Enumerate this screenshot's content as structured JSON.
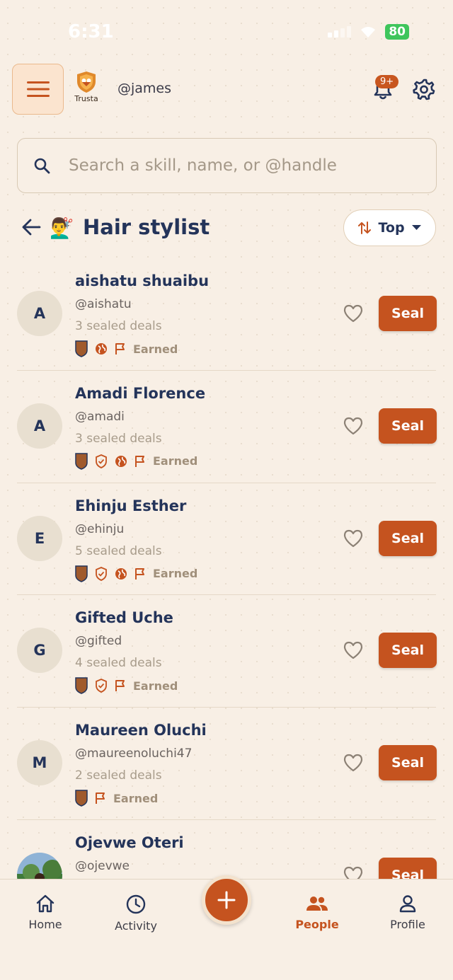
{
  "status": {
    "time": "6:31",
    "battery": "80"
  },
  "header": {
    "logo_text": "Trusta",
    "handle": "@james",
    "notification_badge": "9+"
  },
  "search": {
    "placeholder": "Search a skill, name, or @handle",
    "value": ""
  },
  "category": {
    "emoji": "💇‍♂️",
    "title": "Hair stylist",
    "sort_label": "Top"
  },
  "people": [
    {
      "initial": "A",
      "name": "aishatu shuaibu",
      "handle": "@aishatu",
      "deals": "3 sealed deals",
      "badges": [
        "shield-badge",
        "globe",
        "flag"
      ],
      "earned": "Earned",
      "action": "Seal"
    },
    {
      "initial": "A",
      "name": "Amadi Florence",
      "handle": "@amadi",
      "deals": "3 sealed deals",
      "badges": [
        "shield-badge",
        "shield-check",
        "globe",
        "flag"
      ],
      "earned": "Earned",
      "action": "Seal"
    },
    {
      "initial": "E",
      "name": "Ehinju Esther",
      "handle": "@ehinju",
      "deals": "5 sealed deals",
      "badges": [
        "shield-badge",
        "shield-check",
        "globe",
        "flag"
      ],
      "earned": "Earned",
      "action": "Seal"
    },
    {
      "initial": "G",
      "name": "Gifted Uche",
      "handle": "@gifted",
      "deals": "4 sealed deals",
      "badges": [
        "shield-badge",
        "shield-check",
        "flag"
      ],
      "earned": "Earned",
      "action": "Seal"
    },
    {
      "initial": "M",
      "name": "Maureen Oluchi",
      "handle": "@maureenoluchi47",
      "deals": "2 sealed deals",
      "badges": [
        "shield-badge",
        "flag"
      ],
      "earned": "Earned",
      "action": "Seal"
    },
    {
      "initial": "",
      "name": "Ojevwe Oteri",
      "handle": "@ojevwe",
      "deals": "",
      "badges": [],
      "earned": "",
      "action": "Seal",
      "photo": true
    }
  ],
  "nav": {
    "items": [
      {
        "label": "Home",
        "icon": "home-icon"
      },
      {
        "label": "Activity",
        "icon": "clock-icon"
      },
      {
        "label": "People",
        "icon": "people-icon",
        "active": true
      },
      {
        "label": "Profile",
        "icon": "person-icon"
      }
    ],
    "fab_icon": "plus-icon"
  },
  "colors": {
    "accent": "#c5531f",
    "navy": "#24345a",
    "background": "#f8efe5"
  }
}
